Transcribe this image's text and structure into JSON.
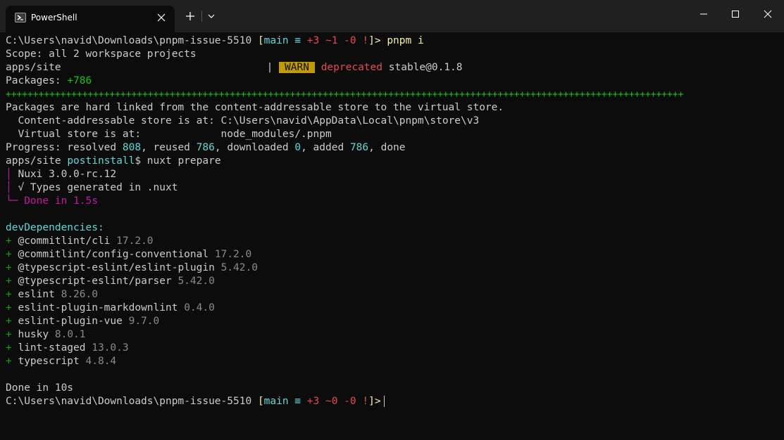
{
  "tab": {
    "title": "PowerShell",
    "icon": "powershell-icon"
  },
  "colors": {
    "bg": "#0c0c0c",
    "titlebar": "#202020",
    "warn": "#c19c00",
    "magenta": "#c019a3",
    "cyan": "#61d6d6",
    "red": "#e74856",
    "green": "#16c60c"
  },
  "prompt1": {
    "path": "C:\\Users\\navid\\Downloads\\pnpm-issue-5510",
    "open": "[",
    "branch": "main",
    "sync": "≡",
    "changes": "+3 ~1 -0 !",
    "close": "]>",
    "command": "pnpm i"
  },
  "lines": {
    "scope": "Scope: all 2 workspace projects",
    "site": "apps/site",
    "bar": "|",
    "warn_label": "WARN",
    "deprecated": "deprecated",
    "stable": "stable@0.1.8",
    "packages_label": "Packages: ",
    "packages_count": "+786",
    "plus_line": "++++++++++++++++++++++++++++++++++++++++++++++++++++++++++++++++++++++++++++++++++++++++++++++++++++++++++++++++++++++++++++",
    "hardlinked": "Packages are hard linked from the content-addressable store to the virtual store.",
    "cas_label": "  Content-addressable store is at: ",
    "cas_path": "C:\\Users\\navid\\AppData\\Local\\pnpm\\store\\v3",
    "vs_label": "  Virtual store is at:             ",
    "vs_path": "node_modules/.pnpm",
    "progress_a": "Progress: resolved ",
    "resolved": "808",
    "progress_b": ", reused ",
    "reused": "786",
    "progress_c": ", downloaded ",
    "downloaded": "0",
    "progress_d": ", added ",
    "added": "786",
    "progress_e": ", done",
    "site2": "apps/site ",
    "postinstall": "postinstall",
    "postcmd": "$ nuxt prepare",
    "nuxi": "Nuxi 3.0.0-rc.12",
    "types": "√ Types generated in .nuxt",
    "done_nuxt": " Done in 1.5s",
    "devdeps": "devDependencies:",
    "done_all": "Done in 10s"
  },
  "deps": [
    {
      "plus": "+ ",
      "name": "@commitlint/cli",
      "version": "17.2.0"
    },
    {
      "plus": "+ ",
      "name": "@commitlint/config-conventional",
      "version": "17.2.0"
    },
    {
      "plus": "+ ",
      "name": "@typescript-eslint/eslint-plugin",
      "version": "5.42.0"
    },
    {
      "plus": "+ ",
      "name": "@typescript-eslint/parser",
      "version": "5.42.0"
    },
    {
      "plus": "+ ",
      "name": "eslint",
      "version": "8.26.0"
    },
    {
      "plus": "+ ",
      "name": "eslint-plugin-markdownlint",
      "version": "0.4.0"
    },
    {
      "plus": "+ ",
      "name": "eslint-plugin-vue",
      "version": "9.7.0"
    },
    {
      "plus": "+ ",
      "name": "husky",
      "version": "8.0.1"
    },
    {
      "plus": "+ ",
      "name": "lint-staged",
      "version": "13.0.3"
    },
    {
      "plus": "+ ",
      "name": "typescript",
      "version": "4.8.4"
    }
  ],
  "prompt2": {
    "path": "C:\\Users\\navid\\Downloads\\pnpm-issue-5510",
    "open": "[",
    "branch": "main",
    "sync": "≡",
    "changes": "+3 ~0 -0 !",
    "close": "]>"
  }
}
